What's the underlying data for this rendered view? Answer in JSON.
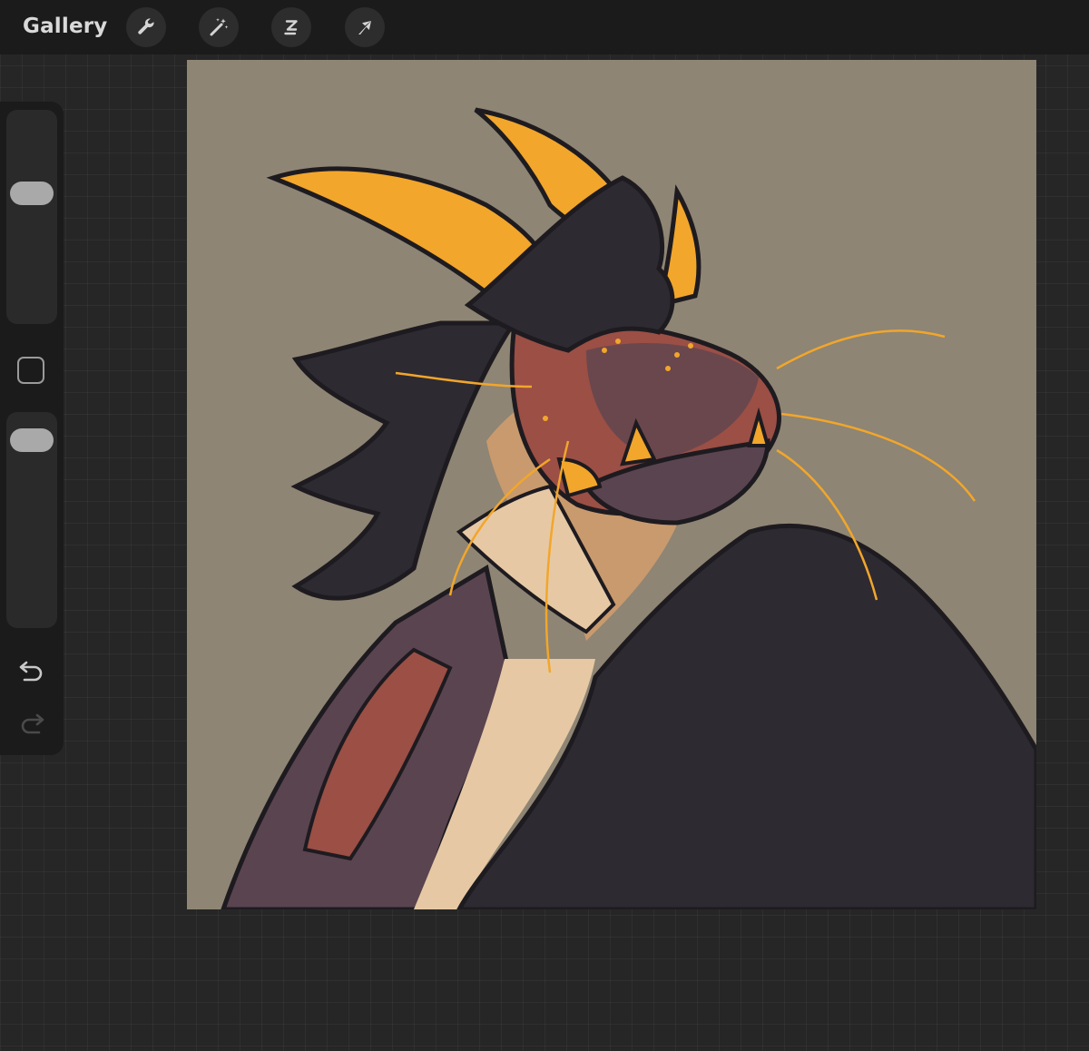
{
  "topbar": {
    "gallery_label": "Gallery",
    "tools": [
      {
        "name": "actions",
        "icon": "wrench-icon"
      },
      {
        "name": "adjustments",
        "icon": "magic-wand-icon"
      },
      {
        "name": "selection",
        "icon": "selection-s-icon"
      },
      {
        "name": "transform",
        "icon": "arrow-cursor-icon"
      }
    ]
  },
  "sidebar": {
    "brush_size_level": 0.63,
    "opacity_level": 0.93,
    "modify_icon": "square-icon",
    "undo_icon": "undo-icon",
    "redo_icon": "redo-icon"
  },
  "canvas": {
    "background_color": "#8e8574",
    "palette": [
      "#2e2a32",
      "#5a4450",
      "#9b4f45",
      "#f2a62b",
      "#e6c9a4",
      "#c99a6d",
      "#1e1b20"
    ]
  }
}
